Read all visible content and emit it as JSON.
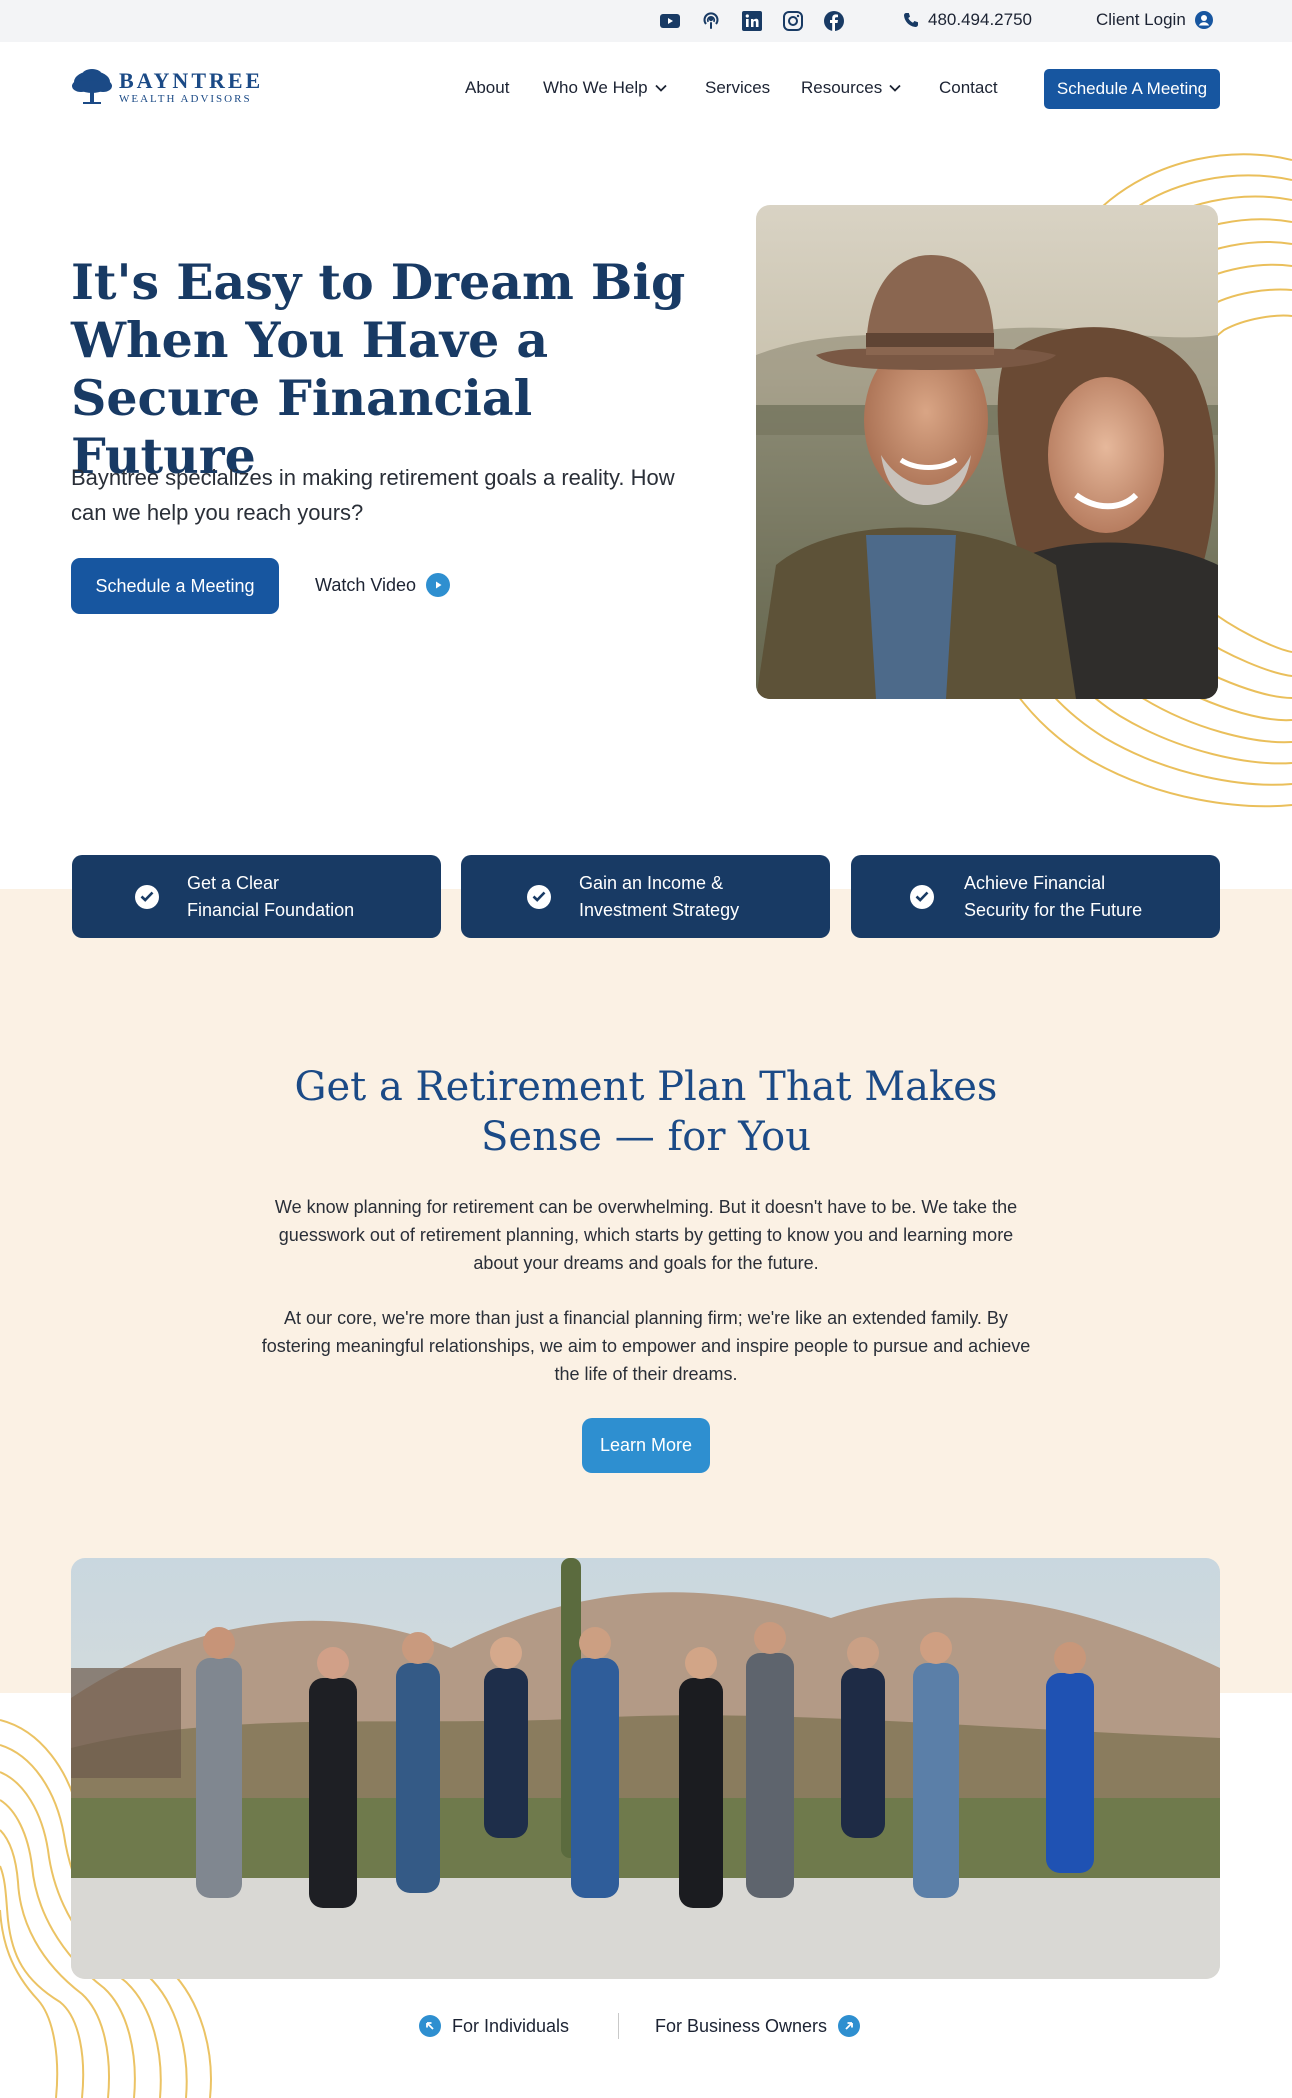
{
  "topbar": {
    "social_icons": [
      "youtube-icon",
      "podcast-icon",
      "linkedin-icon",
      "instagram-icon",
      "facebook-icon"
    ],
    "phone": "480.494.2750",
    "client_login": "Client Login"
  },
  "header": {
    "logo_line1": "BAYNTREE",
    "logo_line2": "WEALTH ADVISORS",
    "nav": {
      "about": "About",
      "who_we_help": "Who We Help",
      "services": "Services",
      "resources": "Resources",
      "contact": "Contact"
    },
    "cta": "Schedule A Meeting"
  },
  "hero": {
    "title": "It's Easy to Dream Big When You Have a Secure Financial Future",
    "subtitle": "Bayntree specializes in making retirement goals a reality. How can we help you reach yours?",
    "primary_button": "Schedule a Meeting",
    "video_link": "Watch Video"
  },
  "benefits": [
    {
      "line1": "Get a Clear",
      "line2": "Financial Foundation"
    },
    {
      "line1": "Gain an Income &",
      "line2": "Investment Strategy"
    },
    {
      "line1": "Achieve Financial",
      "line2": "Security for the Future"
    }
  ],
  "plan": {
    "title": "Get a Retirement Plan That Makes Sense — for You",
    "paragraph1": "We know planning for retirement can be overwhelming. But it doesn't have to be. We take the guesswork out of retirement planning, which starts by getting to know you and learning more about your dreams and goals for the future.",
    "paragraph2": "At our core, we're more than just a financial planning firm; we're like an extended family. By fostering meaningful relationships, we aim to empower and inspire people to pursue and achieve the life of their dreams.",
    "button": "Learn More"
  },
  "audience": {
    "individuals": "For Individuals",
    "business_owners": "For Business Owners"
  },
  "colors": {
    "navy": "#183a64",
    "primary_blue": "#1756a0",
    "accent_blue": "#2e8fd0",
    "beige": "#fbf1e4",
    "contour_gold": "#e8b94a"
  }
}
